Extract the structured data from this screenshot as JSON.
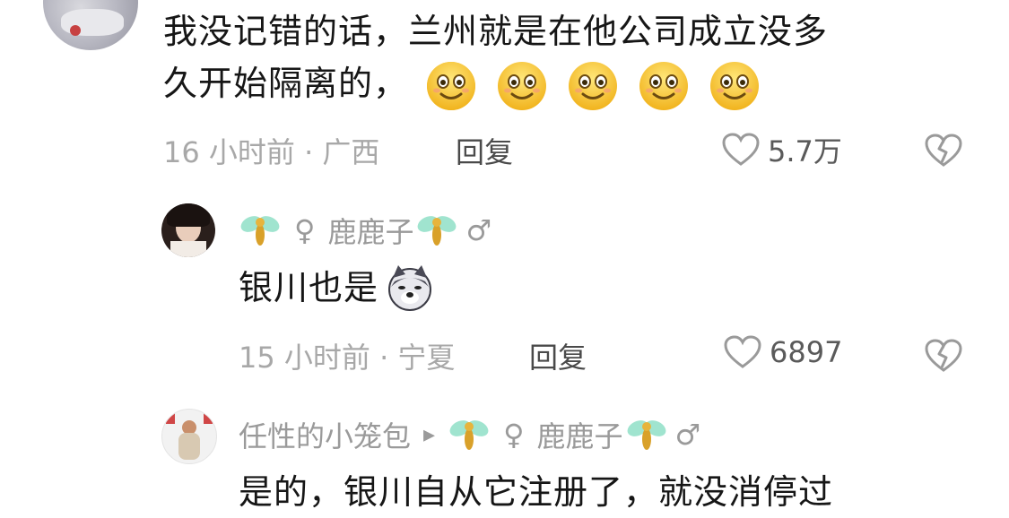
{
  "comment1": {
    "text_line1": "我没记错的话，兰州就是在他公司成立没多",
    "text_line2": "久开始隔离的，",
    "emoji_count": 5,
    "time_location": "16 小时前 · 广西",
    "reply_label": "回复",
    "likes": "5.7万"
  },
  "reply1": {
    "username": "鹿鹿子",
    "text": "银川也是",
    "time_location": "15 小时前 · 宁夏",
    "reply_label": "回复",
    "likes": "6897"
  },
  "reply2": {
    "username": "任性的小笼包",
    "reply_to": "鹿鹿子",
    "text": "是的，银川自从它注册了，就没消停过"
  },
  "icons": {
    "female": "♀",
    "male": "♂",
    "arrow": "▸"
  }
}
